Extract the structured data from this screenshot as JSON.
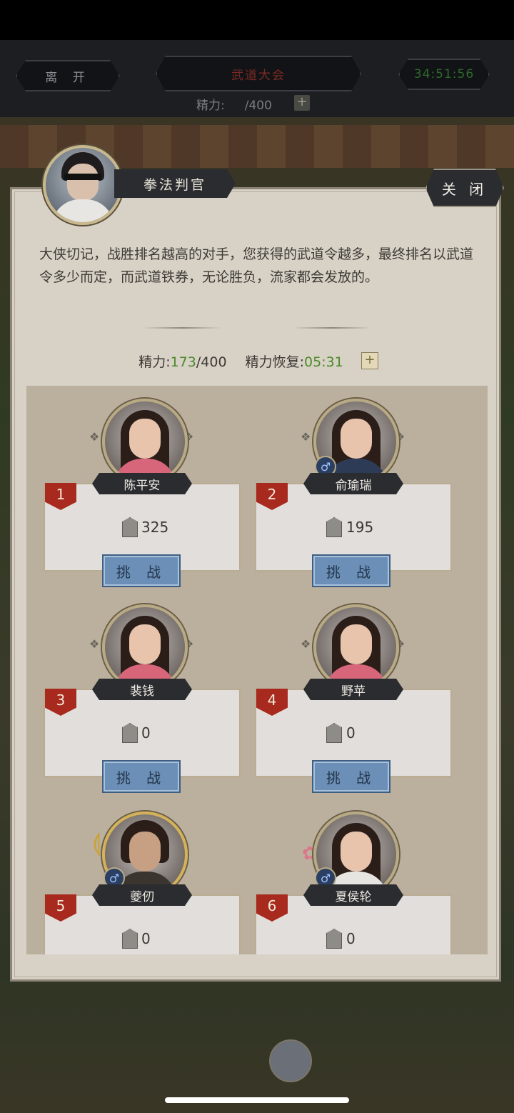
{
  "header": {
    "leave_label": "离 开",
    "title": "武道大会",
    "timer": "34:51:56",
    "stamina_label": "精力:",
    "stamina_max": "/400",
    "plus": "+"
  },
  "dialog": {
    "npc_name": "拳法判官",
    "close_label": "关 闭",
    "description": "大侠切记，战胜排名越高的对手，您获得的武道令越多，最终排名以武道令多少而定，而武道铁券，无论胜负，流家都会发放的。",
    "stamina": {
      "label": "精力:",
      "value": "173",
      "max": "/400",
      "recover_label": "精力恢复:",
      "recover_time": "05:31",
      "plus": "+"
    },
    "challenge_label": "挑 战",
    "opponents": [
      {
        "rank": "1",
        "name": "陈平安",
        "score": "325",
        "gender": "female",
        "outfit": "pink"
      },
      {
        "rank": "2",
        "name": "俞瑜瑞",
        "score": "195",
        "gender": "male",
        "outfit": "blue",
        "male_symbol": "♂"
      },
      {
        "rank": "3",
        "name": "裴钱",
        "score": "0",
        "gender": "female",
        "outfit": "pink"
      },
      {
        "rank": "4",
        "name": "野苹",
        "score": "0",
        "gender": "female",
        "outfit": "pink"
      },
      {
        "rank": "5",
        "name": "夔仞",
        "score": "0",
        "gender": "male",
        "outfit": "dark",
        "male_symbol": "♂"
      },
      {
        "rank": "6",
        "name": "夏侯轮",
        "score": "0",
        "gender": "male",
        "outfit": "white",
        "male_symbol": "♂"
      }
    ]
  },
  "colors": {
    "accent_green": "#4c8a2a",
    "rank_red": "#a8291d",
    "challenge_blue": "#6b8fb6"
  }
}
